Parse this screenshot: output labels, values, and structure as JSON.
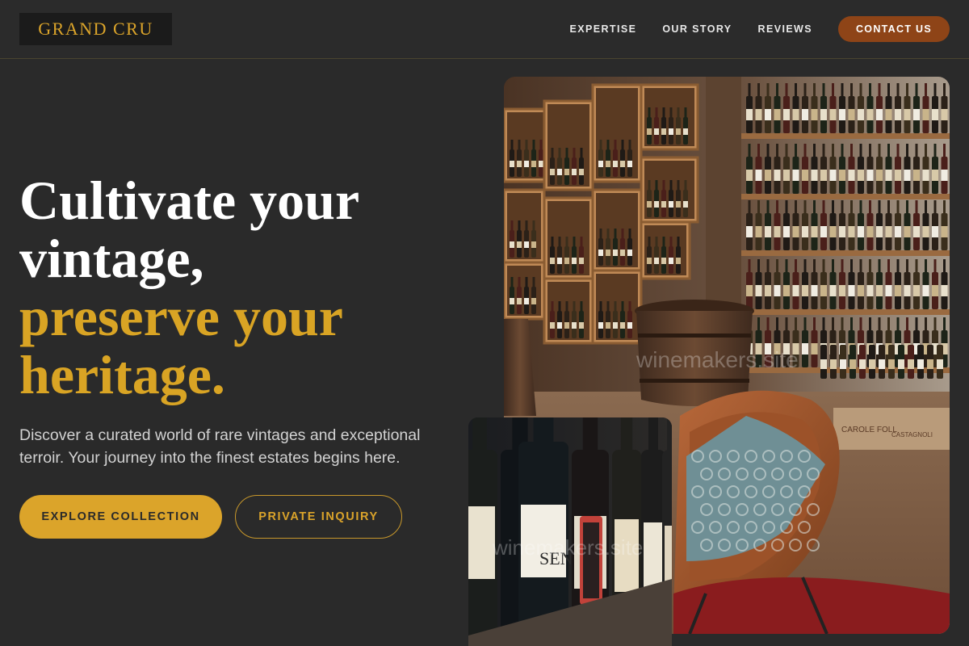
{
  "brand": {
    "name": "GRAND CRU"
  },
  "nav": {
    "links": [
      "EXPERTISE",
      "OUR STORY",
      "REVIEWS"
    ],
    "cta": "CONTACT US"
  },
  "hero": {
    "headline_lines": [
      "Cultivate your",
      "vintage,",
      "preserve your",
      "heritage."
    ],
    "subtext": "Discover a curated world of rare vintages and exceptional terroir. Your journey into the finest estates begins here.",
    "primary_button": "EXPLORE COLLECTION",
    "secondary_button": "PRIVATE INQUIRY"
  },
  "images": {
    "main": {
      "watermark": "winemakers.site",
      "crate_labels": [
        "CAROLE FOLL",
        "CASTAGNOLI"
      ]
    },
    "small": {
      "watermark": "winemakers.site",
      "bottle_label": "SEN"
    }
  },
  "colors": {
    "background": "#2a2a2a",
    "gold": "#dba42a",
    "cta_brown": "#8e4417",
    "text_muted": "#d2d2d2"
  }
}
